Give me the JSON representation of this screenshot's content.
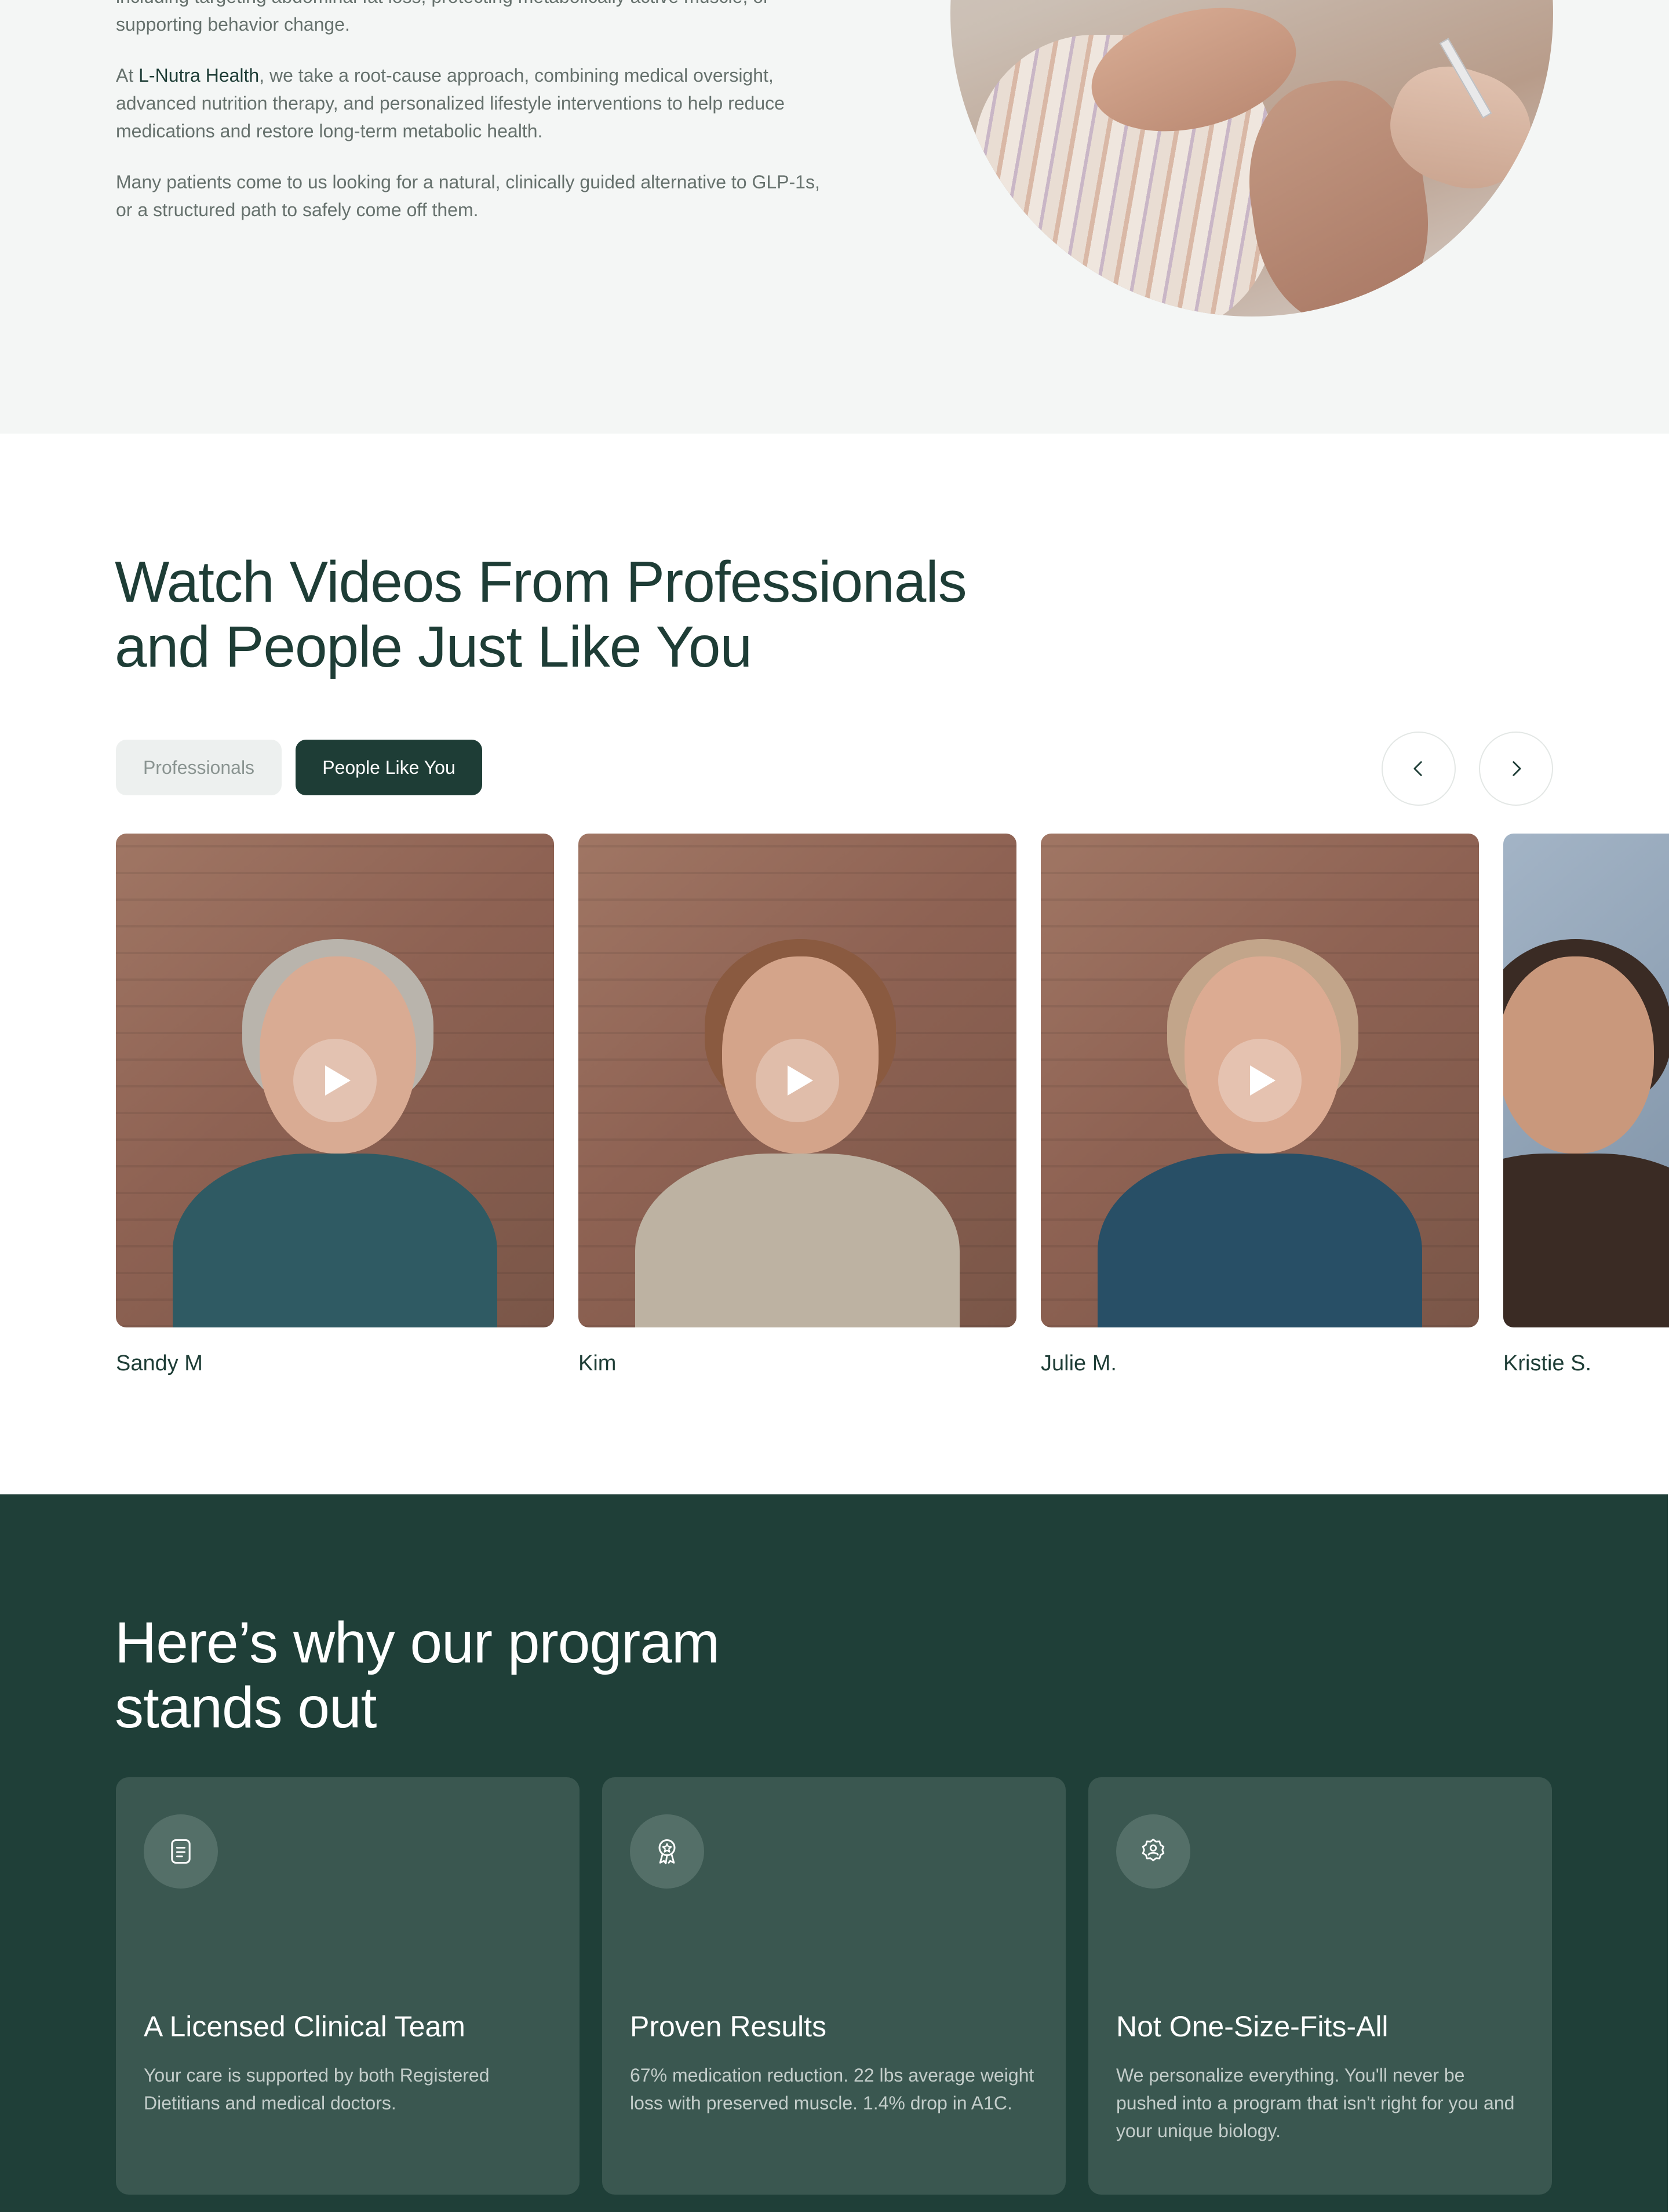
{
  "intro": {
    "paragraphs": [
      "including targeting abdominal fat loss, protecting metabolically active muscle, or supporting behavior change.",
      "Many patients come to us looking for a natural, clinically guided alternative to GLP-1s, or a structured path to safely come off them."
    ],
    "approach_prefix": "At ",
    "brand": "L-Nutra Health",
    "approach_suffix": ", we take a root-cause approach, combining medical oversight, advanced nutrition therapy, and personalized lifestyle interventions to help reduce medications and restore long-term metabolic health."
  },
  "videos": {
    "title_line1": "Watch Videos From Professionals",
    "title_line2": "and People Just Like You",
    "tabs": [
      {
        "label": "Professionals",
        "active": false
      },
      {
        "label": "People Like You",
        "active": true
      }
    ],
    "prev_icon": "chevron-left-icon",
    "next_icon": "chevron-right-icon",
    "cards": [
      {
        "name": "Sandy M"
      },
      {
        "name": "Kim"
      },
      {
        "name": "Julie M."
      },
      {
        "name": "Kristie S."
      }
    ]
  },
  "why": {
    "title_line1": "Here’s why our program",
    "title_line2": "stands out",
    "features": [
      {
        "icon": "document-icon",
        "title": "A Licensed Clinical Team",
        "text": "Your care is supported by both Registered Dietitians and medical doctors."
      },
      {
        "icon": "award-ribbon-icon",
        "title": "Proven Results",
        "text": "67% medication reduction. 22 lbs average weight loss with preserved muscle. 1.4% drop in A1C."
      },
      {
        "icon": "person-badge-icon",
        "title": "Not One-Size-Fits-All",
        "text": "We personalize everything. You'll never be pushed into a program that isn't right for you and your unique biology."
      }
    ]
  },
  "colors": {
    "brand_dark": "#1e3d36",
    "section_dark": "#1f3f38",
    "card_dark": "#3a5750",
    "intro_bg": "#f4f6f5"
  }
}
